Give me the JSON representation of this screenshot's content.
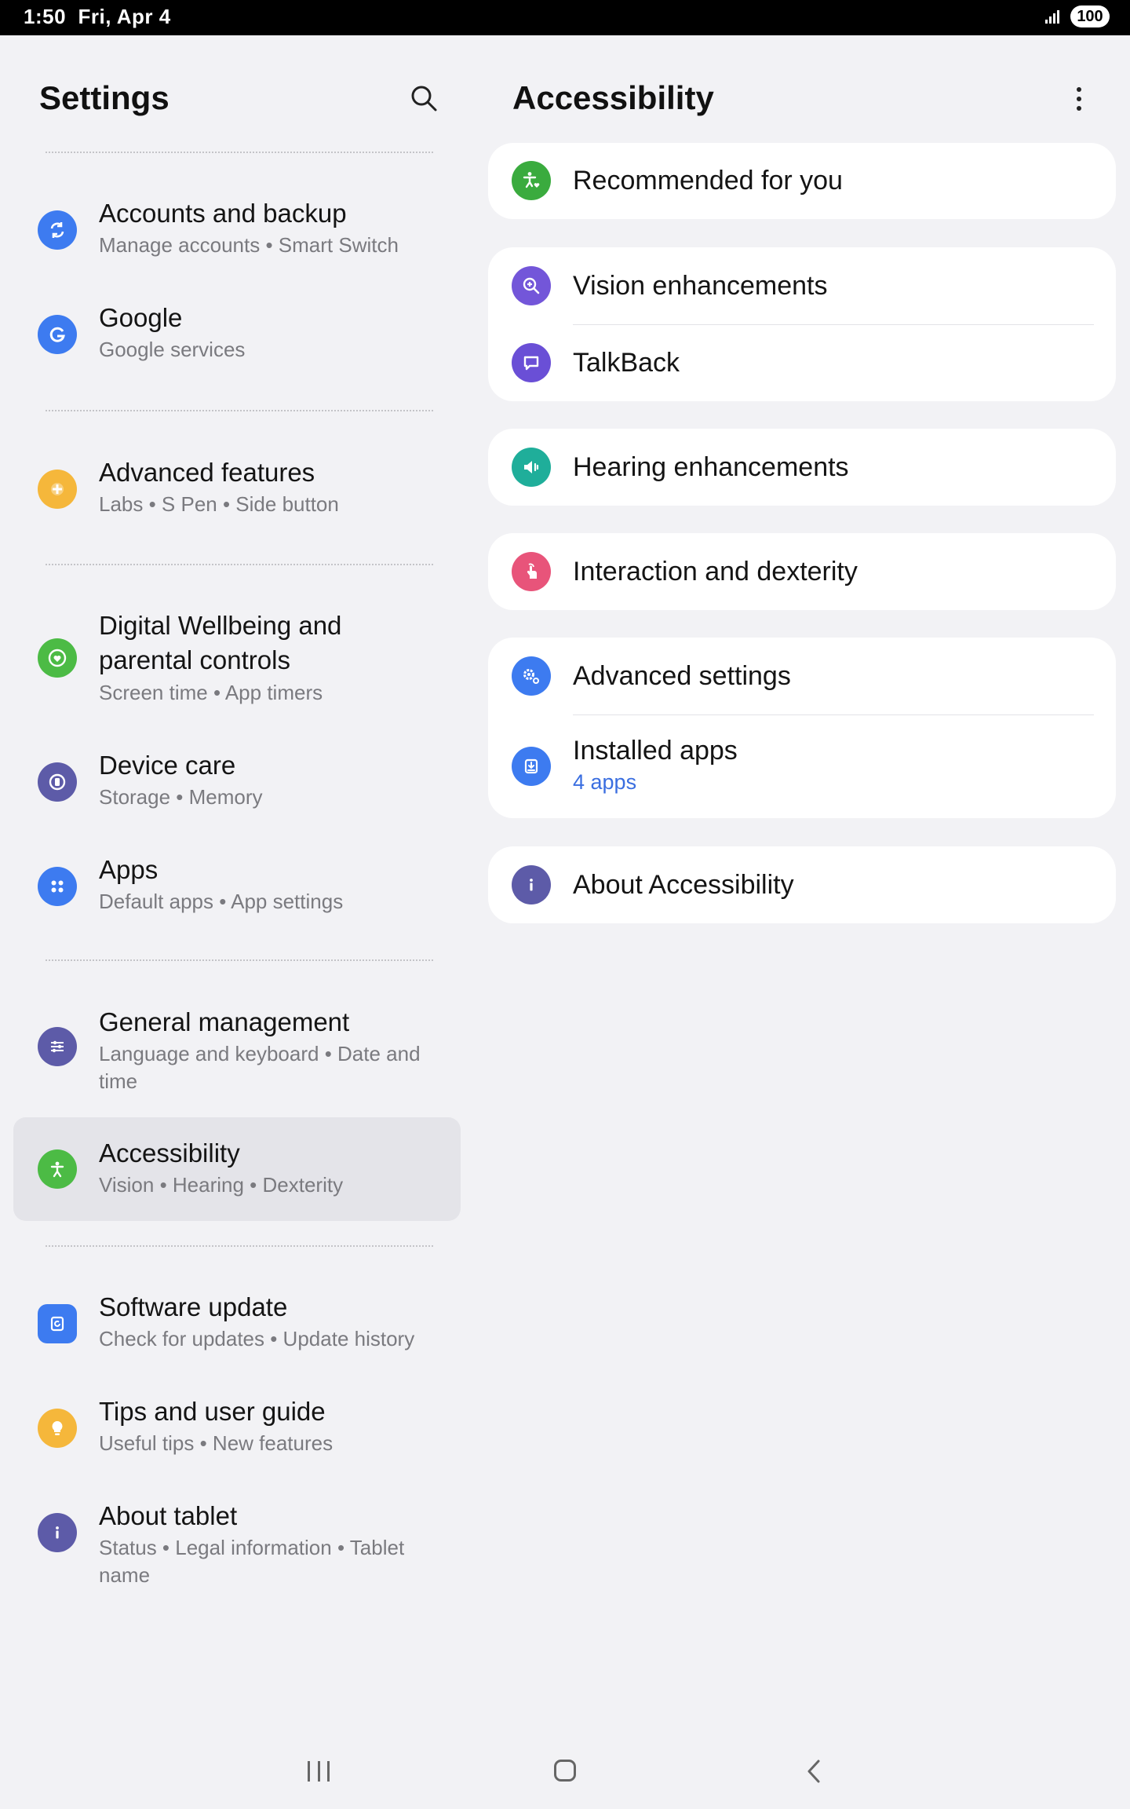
{
  "status_bar": {
    "time": "1:50",
    "date": "Fri, Apr 4",
    "battery": "100"
  },
  "left": {
    "title": "Settings",
    "items": [
      {
        "title": "Accounts and backup",
        "sub": "Manage accounts  •  Smart Switch",
        "color": "#3d7bf0",
        "icon": "sync-icon"
      },
      {
        "title": "Google",
        "sub": "Google services",
        "color": "#3d7bf0",
        "icon": "google-icon"
      },
      {
        "title": "Advanced features",
        "sub": "Labs  •  S Pen  •  Side button",
        "color": "#f5b73b",
        "icon": "plus-gear-icon"
      },
      {
        "title": "Digital Wellbeing and parental controls",
        "sub": "Screen time  •  App timers",
        "color": "#4cbb45",
        "icon": "heart-circle-icon"
      },
      {
        "title": "Device care",
        "sub": "Storage  •  Memory",
        "color": "#5d5ba8",
        "icon": "device-care-icon"
      },
      {
        "title": "Apps",
        "sub": "Default apps  •  App settings",
        "color": "#3d7bf0",
        "icon": "apps-grid-icon"
      },
      {
        "title": "General management",
        "sub": "Language and keyboard  •  Date and time",
        "color": "#5d5ba8",
        "icon": "sliders-icon"
      },
      {
        "title": "Accessibility",
        "sub": "Vision  •  Hearing  •  Dexterity",
        "color": "#4cbb45",
        "icon": "accessibility-icon"
      },
      {
        "title": "Software update",
        "sub": "Check for updates  •  Update history",
        "color": "#3d7bf0",
        "icon": "update-icon"
      },
      {
        "title": "Tips and user guide",
        "sub": "Useful tips  •  New features",
        "color": "#f5b73b",
        "icon": "lightbulb-icon"
      },
      {
        "title": "About tablet",
        "sub": "Status  •  Legal information  •  Tablet name",
        "color": "#5d5ba8",
        "icon": "info-icon"
      }
    ]
  },
  "right": {
    "title": "Accessibility",
    "cards": [
      [
        {
          "label": "Recommended for you",
          "color": "#3aab3e",
          "icon": "accessibility-heart-icon"
        }
      ],
      [
        {
          "label": "Vision enhancements",
          "color": "#7356d9",
          "icon": "magnifier-plus-icon"
        },
        {
          "label": "TalkBack",
          "color": "#6a4fd6",
          "icon": "speech-bubble-icon"
        }
      ],
      [
        {
          "label": "Hearing enhancements",
          "color": "#1fae9a",
          "icon": "speaker-icon"
        }
      ],
      [
        {
          "label": "Interaction and dexterity",
          "color": "#e8547a",
          "icon": "touch-hand-icon"
        }
      ],
      [
        {
          "label": "Advanced settings",
          "color": "#3d7bf0",
          "icon": "gears-icon"
        },
        {
          "label": "Installed apps",
          "sub": "4 apps",
          "color": "#3d7bf0",
          "icon": "download-icon"
        }
      ],
      [
        {
          "label": "About Accessibility",
          "color": "#5d5ba8",
          "icon": "info-icon"
        }
      ]
    ]
  }
}
